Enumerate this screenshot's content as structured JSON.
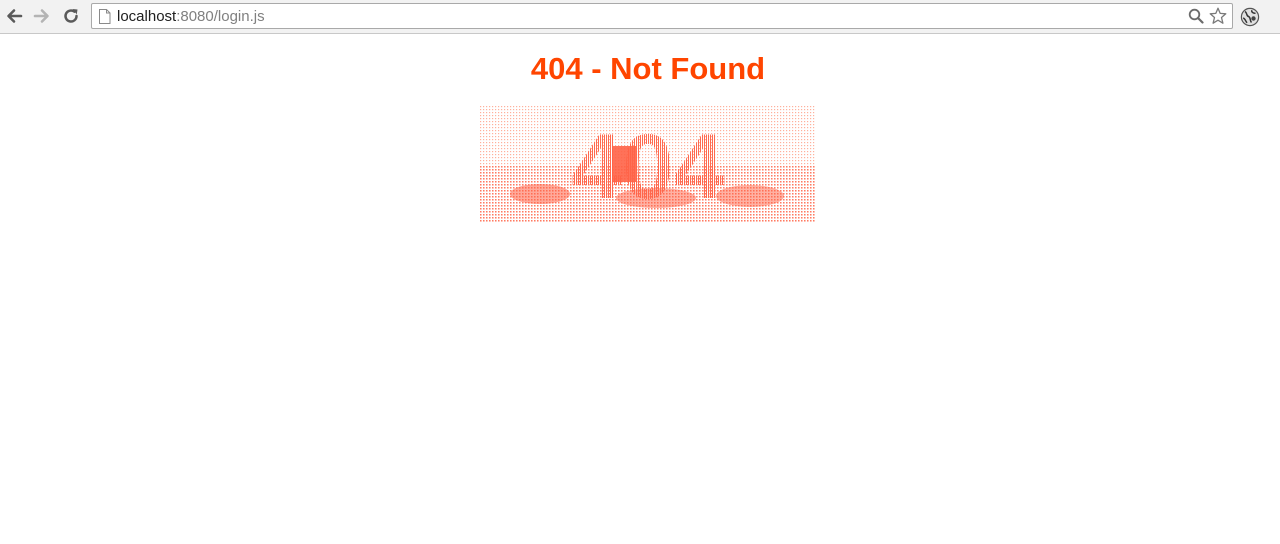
{
  "browser": {
    "url_host": "localhost",
    "url_rest": ":8080/login.js",
    "nav_icons": [
      "back-arrow-icon",
      "forward-arrow-icon",
      "reload-icon"
    ],
    "omnibox_icons": [
      "page-icon",
      "magnifier-icon",
      "star-icon"
    ],
    "extension_icon": "globe-extension-icon"
  },
  "page": {
    "heading": "404 - Not Found",
    "heading_color": "#ff4500",
    "illustration_text": "404",
    "illustration_color": "#ff6347",
    "background": "#ffffff"
  }
}
